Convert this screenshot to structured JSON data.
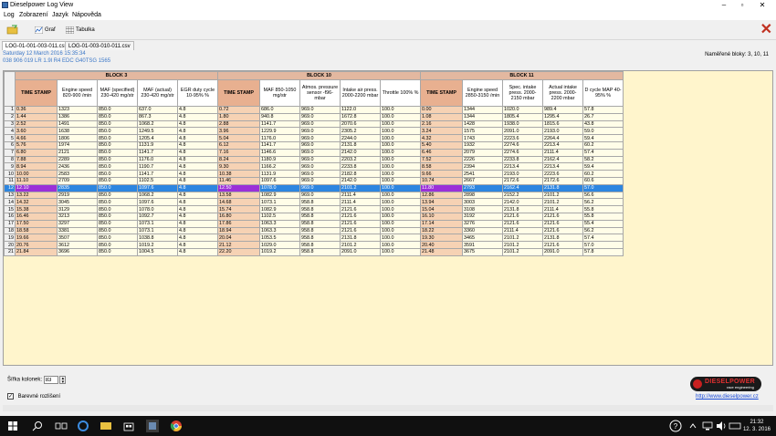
{
  "window": {
    "title": "Dieselpower Log View"
  },
  "menu": [
    "Log",
    "Zobrazení",
    "Jazyk",
    "Nápověda"
  ],
  "toolbar": {
    "graph_label": "Graf",
    "table_label": "Tabulka"
  },
  "tabs": [
    "LOG-01-001-003-011.csv",
    "LOG-01-003-010-011.csv"
  ],
  "info": {
    "date": "Saturday 12 March 2016 15:35:34",
    "vehicle": "038 906 019 LR  1.9l R4 EDC G40TSG  1565",
    "measured_blocks": "Naměřené bloky: 3, 10, 11"
  },
  "table": {
    "blocks": [
      {
        "label": "BLOCK 3",
        "span": 5
      },
      {
        "label": "BLOCK 10",
        "span": 5
      },
      {
        "label": "BLOCK 11",
        "span": 5
      }
    ],
    "headers": [
      "TIME STAMP",
      "Engine speed 820-900 /min",
      "MAF (specified) 230-420 mg/str",
      "MAF (actual) 230-420 mg/str",
      "EGR duty cycle 10-95% %",
      "TIME STAMP",
      "MAF 850-1050 mg/str",
      "Atmos. pressure sensor -f96- mbar",
      "Intake air press. 2000-2200 mbar",
      "Throttle 100% %",
      "TIME STAMP",
      "Engine speed 2850-3150 /min",
      "Spec. intake press. 2000-2150 mbar",
      "Actual intake press. 2000-2200 mbar",
      "D cycle MAP 40-95% %"
    ],
    "selected_row": 12,
    "rows": [
      [
        "0.36",
        "1323",
        "850.0",
        "637.0",
        "4.8",
        "0.72",
        "686.0",
        "969.0",
        "1122.0",
        "100.0",
        "0.00",
        "1344",
        "1020.0",
        "989.4",
        "57.8"
      ],
      [
        "1.44",
        "1386",
        "850.0",
        "867.3",
        "4.8",
        "1.80",
        "940.8",
        "969.0",
        "1672.8",
        "100.0",
        "1.08",
        "1344",
        "1805.4",
        "1295.4",
        "26.7"
      ],
      [
        "2.52",
        "1491",
        "850.0",
        "1068.2",
        "4.8",
        "2.88",
        "1141.7",
        "969.0",
        "2070.6",
        "100.0",
        "2.16",
        "1428",
        "1938.0",
        "1815.6",
        "43.8"
      ],
      [
        "3.60",
        "1638",
        "850.0",
        "1249.5",
        "4.8",
        "3.96",
        "1229.9",
        "969.0",
        "2305.2",
        "100.0",
        "3.24",
        "1575",
        "2091.0",
        "2193.0",
        "59.0"
      ],
      [
        "4.66",
        "1806",
        "850.0",
        "1205.4",
        "4.8",
        "5.04",
        "1176.0",
        "969.0",
        "2244.0",
        "100.0",
        "4.32",
        "1743",
        "2223.6",
        "2264.4",
        "59.4"
      ],
      [
        "5.76",
        "1974",
        "850.0",
        "1131.9",
        "4.8",
        "6.12",
        "1141.7",
        "969.0",
        "2131.8",
        "100.0",
        "5.40",
        "1932",
        "2274.6",
        "2213.4",
        "60.2"
      ],
      [
        "6.80",
        "2121",
        "850.0",
        "1141.7",
        "4.8",
        "7.16",
        "1146.6",
        "969.0",
        "2142.0",
        "100.0",
        "6.46",
        "2079",
        "2274.6",
        "2111.4",
        "57.4"
      ],
      [
        "7.88",
        "2289",
        "850.0",
        "1176.0",
        "4.8",
        "8.24",
        "1180.9",
        "969.0",
        "2203.2",
        "100.0",
        "7.52",
        "2226",
        "2233.8",
        "2162.4",
        "58.2"
      ],
      [
        "8.94",
        "2436",
        "850.0",
        "1190.7",
        "4.8",
        "9.30",
        "1166.2",
        "969.0",
        "2233.8",
        "100.0",
        "8.58",
        "2394",
        "2213.4",
        "2213.4",
        "59.4"
      ],
      [
        "10.00",
        "2583",
        "850.0",
        "1141.7",
        "4.8",
        "10.38",
        "1131.9",
        "969.0",
        "2182.8",
        "100.0",
        "9.66",
        "2541",
        "2193.0",
        "2223.6",
        "60.2"
      ],
      [
        "11.10",
        "2709",
        "850.0",
        "1102.5",
        "4.8",
        "11.46",
        "1097.6",
        "969.0",
        "2142.0",
        "100.0",
        "10.74",
        "2667",
        "2172.6",
        "2172.6",
        "60.6"
      ],
      [
        "12.10",
        "2835",
        "850.0",
        "1097.6",
        "4.8",
        "12.50",
        "1078.0",
        "969.0",
        "2101.2",
        "100.0",
        "11.80",
        "2793",
        "2162.4",
        "2131.8",
        "57.0"
      ],
      [
        "13.22",
        "2919",
        "850.0",
        "1068.2",
        "4.8",
        "13.58",
        "1082.9",
        "969.0",
        "2111.4",
        "100.0",
        "12.86",
        "2898",
        "2152.2",
        "2101.2",
        "56.6"
      ],
      [
        "14.32",
        "3045",
        "850.0",
        "1097.6",
        "4.8",
        "14.68",
        "1073.1",
        "958.8",
        "2111.4",
        "100.0",
        "13.94",
        "3003",
        "2142.0",
        "2101.2",
        "56.2"
      ],
      [
        "15.38",
        "3129",
        "850.0",
        "1078.0",
        "4.8",
        "15.74",
        "1082.9",
        "958.8",
        "2121.6",
        "100.0",
        "15.04",
        "3108",
        "2131.8",
        "2111.4",
        "55.8"
      ],
      [
        "16.46",
        "3213",
        "850.0",
        "1092.7",
        "4.8",
        "16.80",
        "1102.5",
        "958.8",
        "2121.6",
        "100.0",
        "16.10",
        "3192",
        "2121.6",
        "2121.6",
        "55.8"
      ],
      [
        "17.50",
        "3297",
        "850.0",
        "1073.1",
        "4.8",
        "17.86",
        "1063.3",
        "958.8",
        "2121.6",
        "100.0",
        "17.14",
        "3276",
        "2121.6",
        "2121.6",
        "55.4"
      ],
      [
        "18.58",
        "3381",
        "850.0",
        "1073.1",
        "4.8",
        "18.94",
        "1063.3",
        "958.8",
        "2121.6",
        "100.0",
        "18.22",
        "3360",
        "2111.4",
        "2121.6",
        "56.2"
      ],
      [
        "19.66",
        "3507",
        "850.0",
        "1038.8",
        "4.8",
        "20.04",
        "1053.5",
        "958.8",
        "2131.8",
        "100.0",
        "19.30",
        "3465",
        "2101.2",
        "2131.8",
        "57.4"
      ],
      [
        "20.76",
        "3612",
        "850.0",
        "1019.2",
        "4.8",
        "21.12",
        "1029.0",
        "958.8",
        "2101.2",
        "100.0",
        "20.40",
        "3591",
        "2101.2",
        "2121.6",
        "57.0"
      ],
      [
        "21.84",
        "3696",
        "850.0",
        "1004.5",
        "4.8",
        "22.20",
        "1019.2",
        "958.8",
        "2091.0",
        "100.0",
        "21.48",
        "3675",
        "2101.2",
        "2091.0",
        "57.8"
      ]
    ]
  },
  "footer": {
    "column_width_label": "Šířka kolonek:",
    "column_width_value": "83",
    "color_toggle_label": "Barevné rozlišení",
    "color_toggle_checked": true,
    "logo_text": "DIESELPOWER",
    "logo_subtext": "race engineering",
    "website": "http://www.dieselpower.cz"
  },
  "taskbar": {
    "time": "21:32",
    "date": "12. 3. 2016"
  },
  "colors": {
    "block_header": "#e3b8a0",
    "timestamp": "#f6d2b4",
    "selected_row": "#2d86e0",
    "selected_timestamp": "#9b30d8",
    "grid_bg": "#fff5cc"
  }
}
